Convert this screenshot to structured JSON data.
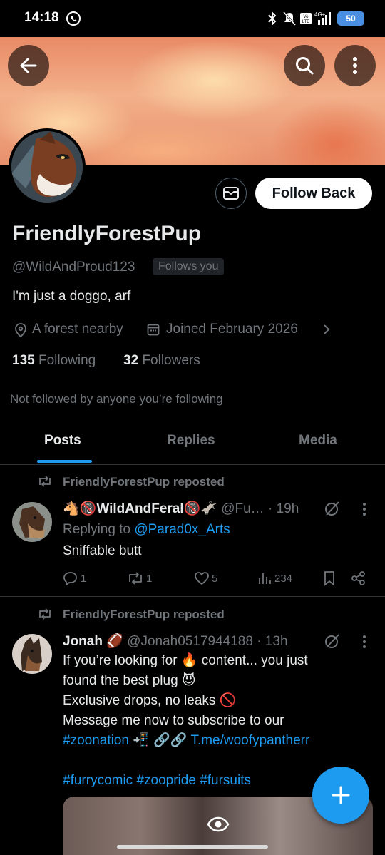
{
  "status_bar": {
    "time": "14:18",
    "battery": "50",
    "network": "4G+"
  },
  "profile": {
    "display_name": "FriendlyForestPup",
    "handle": "@WildAndProud123",
    "follows_you": "Follows you",
    "bio": "I'm just a doggo, arf",
    "location": "A forest nearby",
    "joined": "Joined February 2026",
    "following_count": "135",
    "following_label": "Following",
    "followers_count": "32",
    "followers_label": "Followers",
    "not_followed": "Not followed by anyone you’re following",
    "follow_button": "Follow Back"
  },
  "tabs": [
    {
      "label": "Posts",
      "active": true
    },
    {
      "label": "Replies",
      "active": false
    },
    {
      "label": "Media",
      "active": false
    }
  ],
  "posts": [
    {
      "repost_label": "FriendlyForestPup reposted",
      "author_name": "WildAndFeral",
      "author_prefix_emoji": "🐴🔞",
      "author_suffix_emoji": "🔞🫏",
      "author_handle": "@Fu…",
      "time": "· 19h",
      "replying_prefix": "Replying to ",
      "replying_to": "@Parad0x_Arts",
      "text": "Sniffable butt",
      "replies": "1",
      "reposts": "1",
      "likes": "5",
      "views": "234"
    },
    {
      "repost_label": "FriendlyForestPup reposted",
      "author_name": "Jonah",
      "author_suffix_emoji": "🏈",
      "author_handle": "@Jonah0517944188",
      "time": "· 13h",
      "line1": "If you’re looking for 🔥 content... you just",
      "line2": "found the best plug 😈",
      "line3": "Exclusive drops, no leaks 🚫",
      "line4": "Message me now to subscribe to our",
      "hashtag1": "#zoonation",
      "emoji_mid": " 📲 🔗🔗 ",
      "link": "T.me/woofypantherr",
      "hashtags": "#furrycomic #zoopride #fursuits"
    }
  ],
  "colors": {
    "accent": "#1d9bf0",
    "muted": "#71767b",
    "text": "#e7e9ea",
    "background": "#000000"
  }
}
